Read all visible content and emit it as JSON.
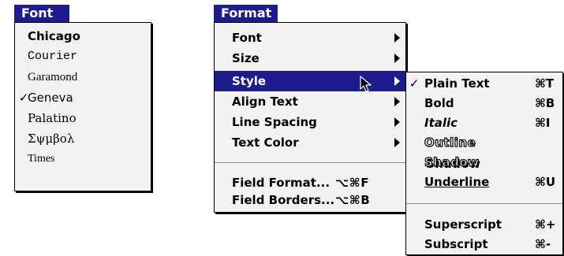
{
  "font_menu": {
    "title": "Font",
    "items": [
      {
        "label": "Chicago",
        "checked": false
      },
      {
        "label": "Courier",
        "checked": false
      },
      {
        "label": "Garamond",
        "checked": false
      },
      {
        "label": "Geneva",
        "checked": true
      },
      {
        "label": "Palatino",
        "checked": false
      },
      {
        "label": "Σψμβολ",
        "checked": false
      },
      {
        "label": "Times",
        "checked": false
      }
    ],
    "check_glyph": "✓"
  },
  "format_menu": {
    "title": "Format",
    "items": [
      {
        "label": "Font"
      },
      {
        "label": "Size"
      },
      {
        "label": "Style"
      },
      {
        "label": "Align Text"
      },
      {
        "label": "Line Spacing"
      },
      {
        "label": "Text Color"
      }
    ],
    "field_items": [
      {
        "label": "Field Format...",
        "shortcut": "⌥⌘F"
      },
      {
        "label": "Field Borders...",
        "shortcut": "⌥⌘B"
      }
    ]
  },
  "style_menu": {
    "check_glyph": "✓",
    "items": [
      {
        "label": "Plain Text",
        "shortcut": "⌘T"
      },
      {
        "label": "Bold",
        "shortcut": "⌘B"
      },
      {
        "label": "Italic",
        "shortcut": "⌘I"
      },
      {
        "label": "Outline",
        "shortcut": ""
      },
      {
        "label": "Shadow",
        "shortcut": ""
      },
      {
        "label": "Underline",
        "shortcut": "⌘U"
      }
    ],
    "script_items": [
      {
        "label": "Superscript",
        "shortcut": "⌘+"
      },
      {
        "label": "Subscript",
        "shortcut": "⌘-"
      }
    ]
  },
  "colors": {
    "highlight": "#1c1c8e",
    "menu_bg": "#f2f2f2"
  }
}
